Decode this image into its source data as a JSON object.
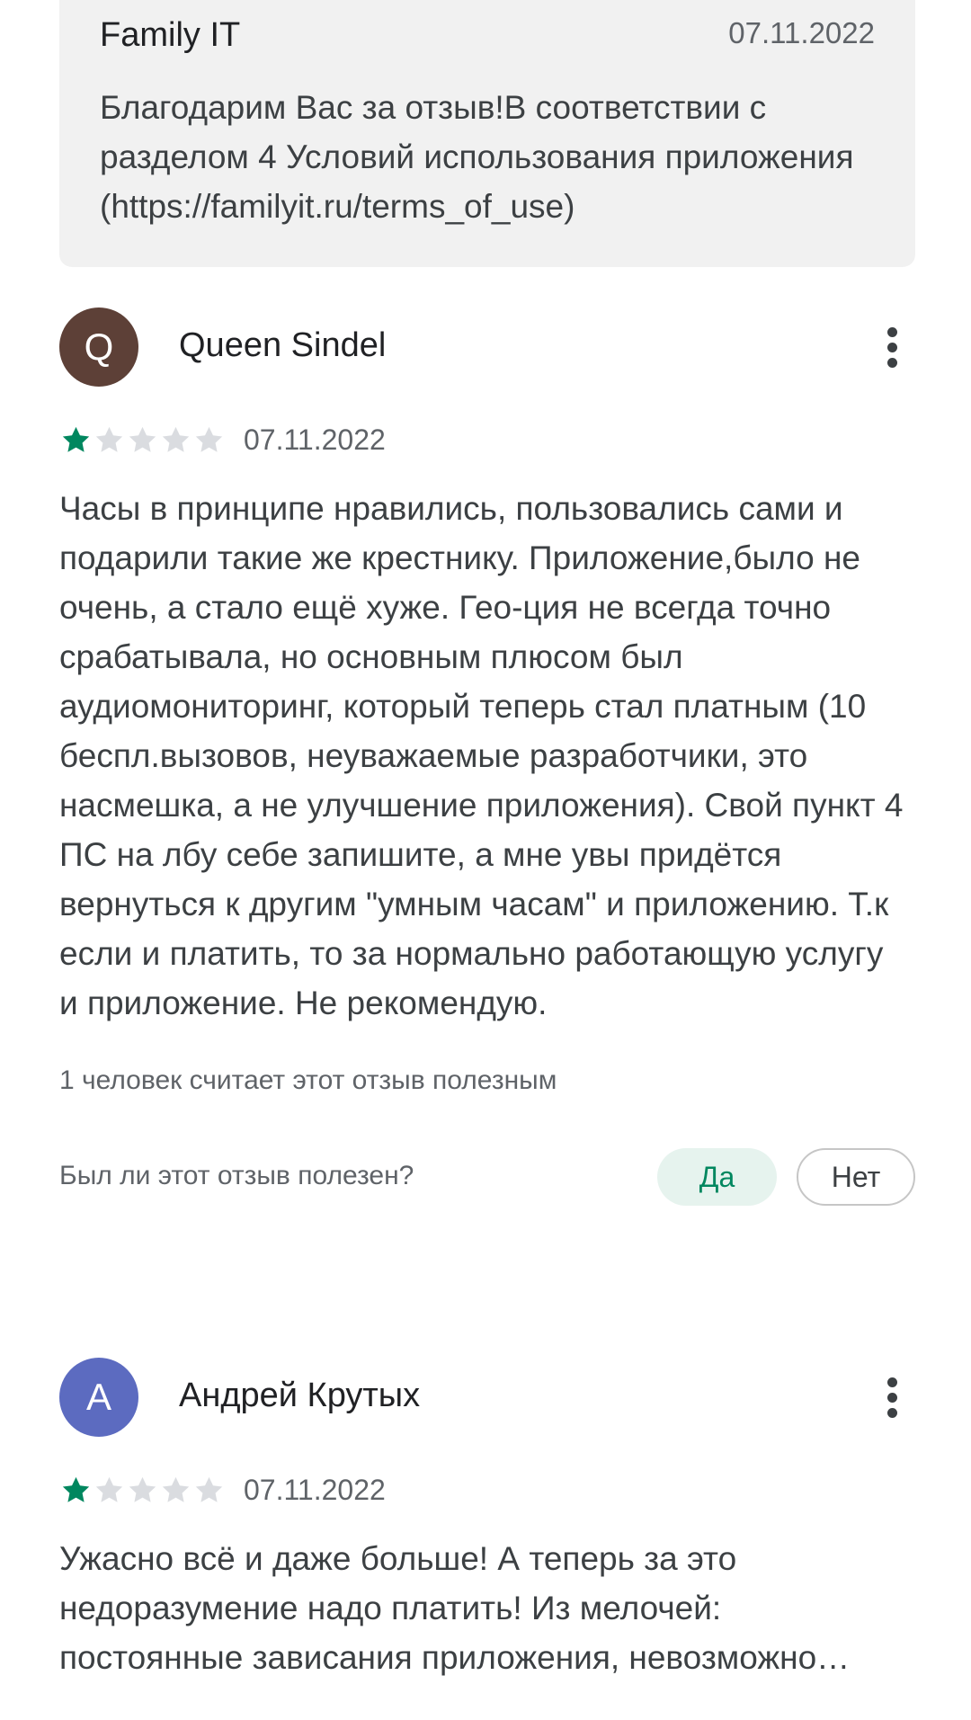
{
  "developer_reply": {
    "author": "Family IT",
    "date": "07.11.2022",
    "text": "Благодарим Вас за отзыв!В соответствии с разделом 4 Условий использования приложения (https://familyit.ru/terms_of_use)"
  },
  "reviews": [
    {
      "avatar_letter": "Q",
      "avatar_color": "#5d4037",
      "name": "Queen Sindel",
      "rating": 1,
      "max_rating": 5,
      "date": "07.11.2022",
      "text": "Часы в принципе нравились, пользовались сами и подарили такие же крестнику. Приложение,было не очень, а стало ещё хуже. Гео-ция не всегда точно срабатывала, но основным плюсом был аудиомониторинг, который теперь стал платным (10 беспл.вызовов, неуважаемые разработчики, это насмешка, а не улучшение приложения). Свой пункт 4 ПС на лбу себе запишите, а мне увы придётся вернуться к другим \"умным часам\" и приложению. Т.к если и платить, то за нормально работающую услугу и приложение. Не рекомендую.",
      "helpful_count": "1 человек считает этот отзыв полезным",
      "helpful_question": "Был ли этот отзыв полезен?",
      "yes_label": "Да",
      "no_label": "Нет",
      "more_icon": "more-vert-icon"
    },
    {
      "avatar_letter": "А",
      "avatar_color": "#5c6bc0",
      "name": "Андрей Крутых",
      "rating": 1,
      "max_rating": 5,
      "date": "07.11.2022",
      "text": "Ужасно всё и даже больше! А теперь за это недоразумение надо платить! Из мелочей: постоянные зависания приложения, невозможно…",
      "more_icon": "more-vert-icon"
    }
  ],
  "colors": {
    "star_filled": "#01875f",
    "star_empty": "#dadce0",
    "accent": "#01875f"
  }
}
